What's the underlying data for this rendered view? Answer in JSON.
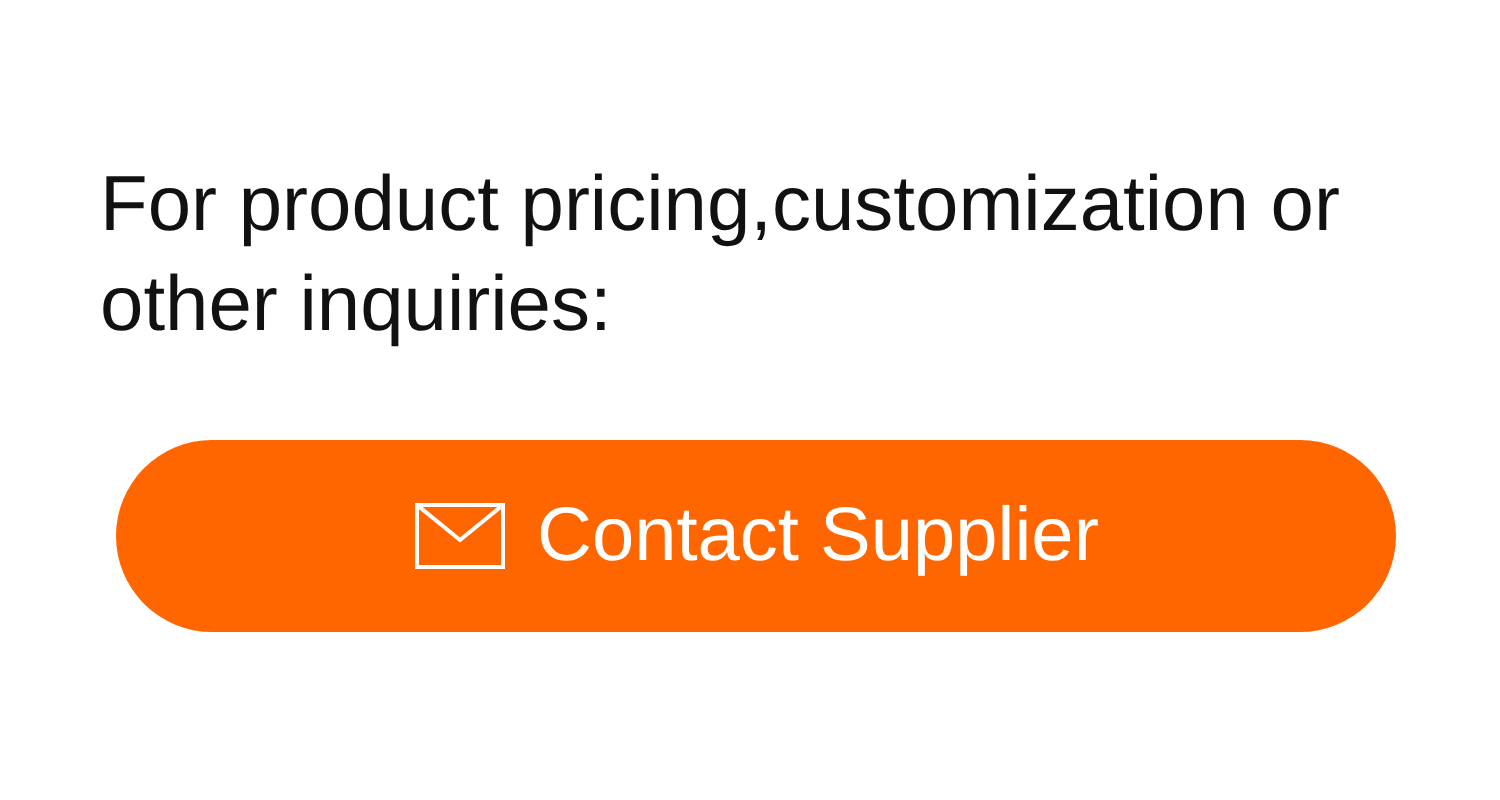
{
  "message": "For product pricing,customization or other inquiries:",
  "button": {
    "label": "Contact Supplier"
  }
}
